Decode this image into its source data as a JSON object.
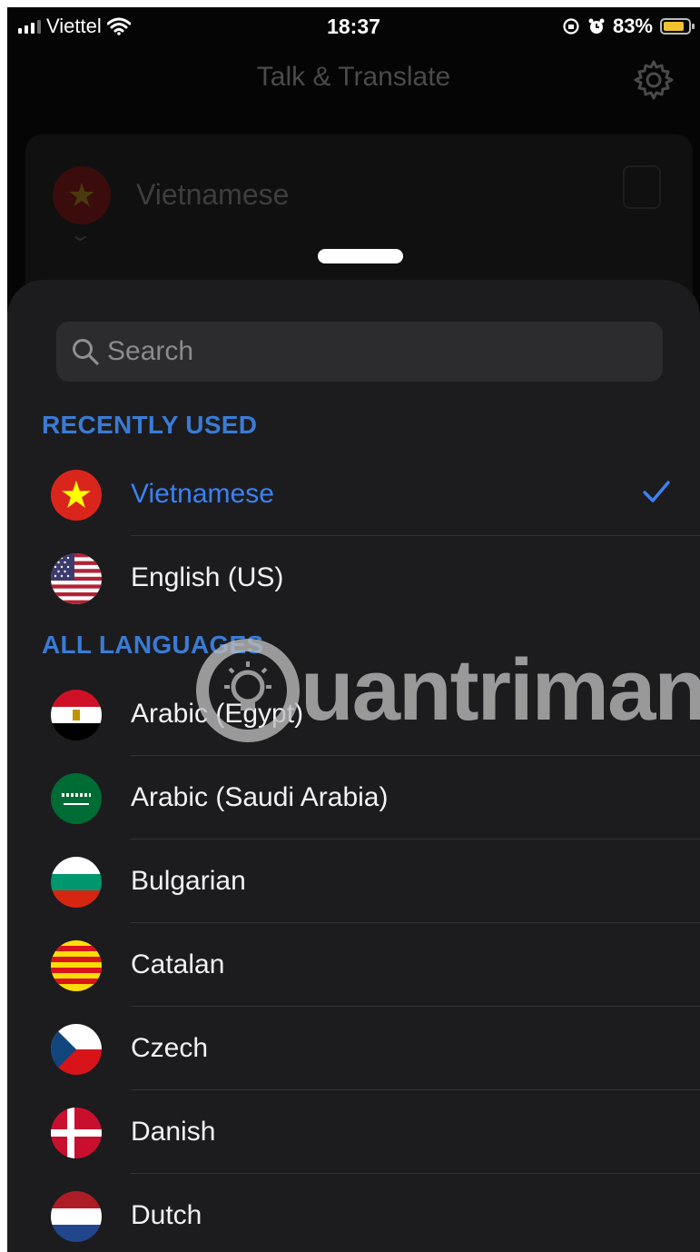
{
  "status_bar": {
    "carrier": "Viettel",
    "time": "18:37",
    "battery_percent": "83%",
    "battery_level": 0.83
  },
  "header": {
    "title": "Talk & Translate"
  },
  "background_card": {
    "language": "Vietnamese"
  },
  "search": {
    "placeholder": "Search"
  },
  "sections": {
    "recent": "RECENTLY USED",
    "all": "ALL LANGUAGES"
  },
  "recent_languages": [
    {
      "label": "Vietnamese",
      "flag": "vietnam-flag-icon",
      "selected": true
    },
    {
      "label": "English (US)",
      "flag": "us-flag-icon",
      "selected": false
    }
  ],
  "all_languages": [
    {
      "label": "Arabic (Egypt)",
      "flag": "egypt-flag-icon"
    },
    {
      "label": "Arabic (Saudi Arabia)",
      "flag": "saudi-arabia-flag-icon"
    },
    {
      "label": "Bulgarian",
      "flag": "bulgaria-flag-icon"
    },
    {
      "label": "Catalan",
      "flag": "catalonia-flag-icon"
    },
    {
      "label": "Czech",
      "flag": "czech-flag-icon"
    },
    {
      "label": "Danish",
      "flag": "denmark-flag-icon"
    },
    {
      "label": "Dutch",
      "flag": "netherlands-flag-icon"
    }
  ],
  "watermark": {
    "text": "uantrimang"
  },
  "colors": {
    "accent": "#3a82f6",
    "sheet": "#1c1c1e",
    "section_header": "#3a7bd5"
  }
}
